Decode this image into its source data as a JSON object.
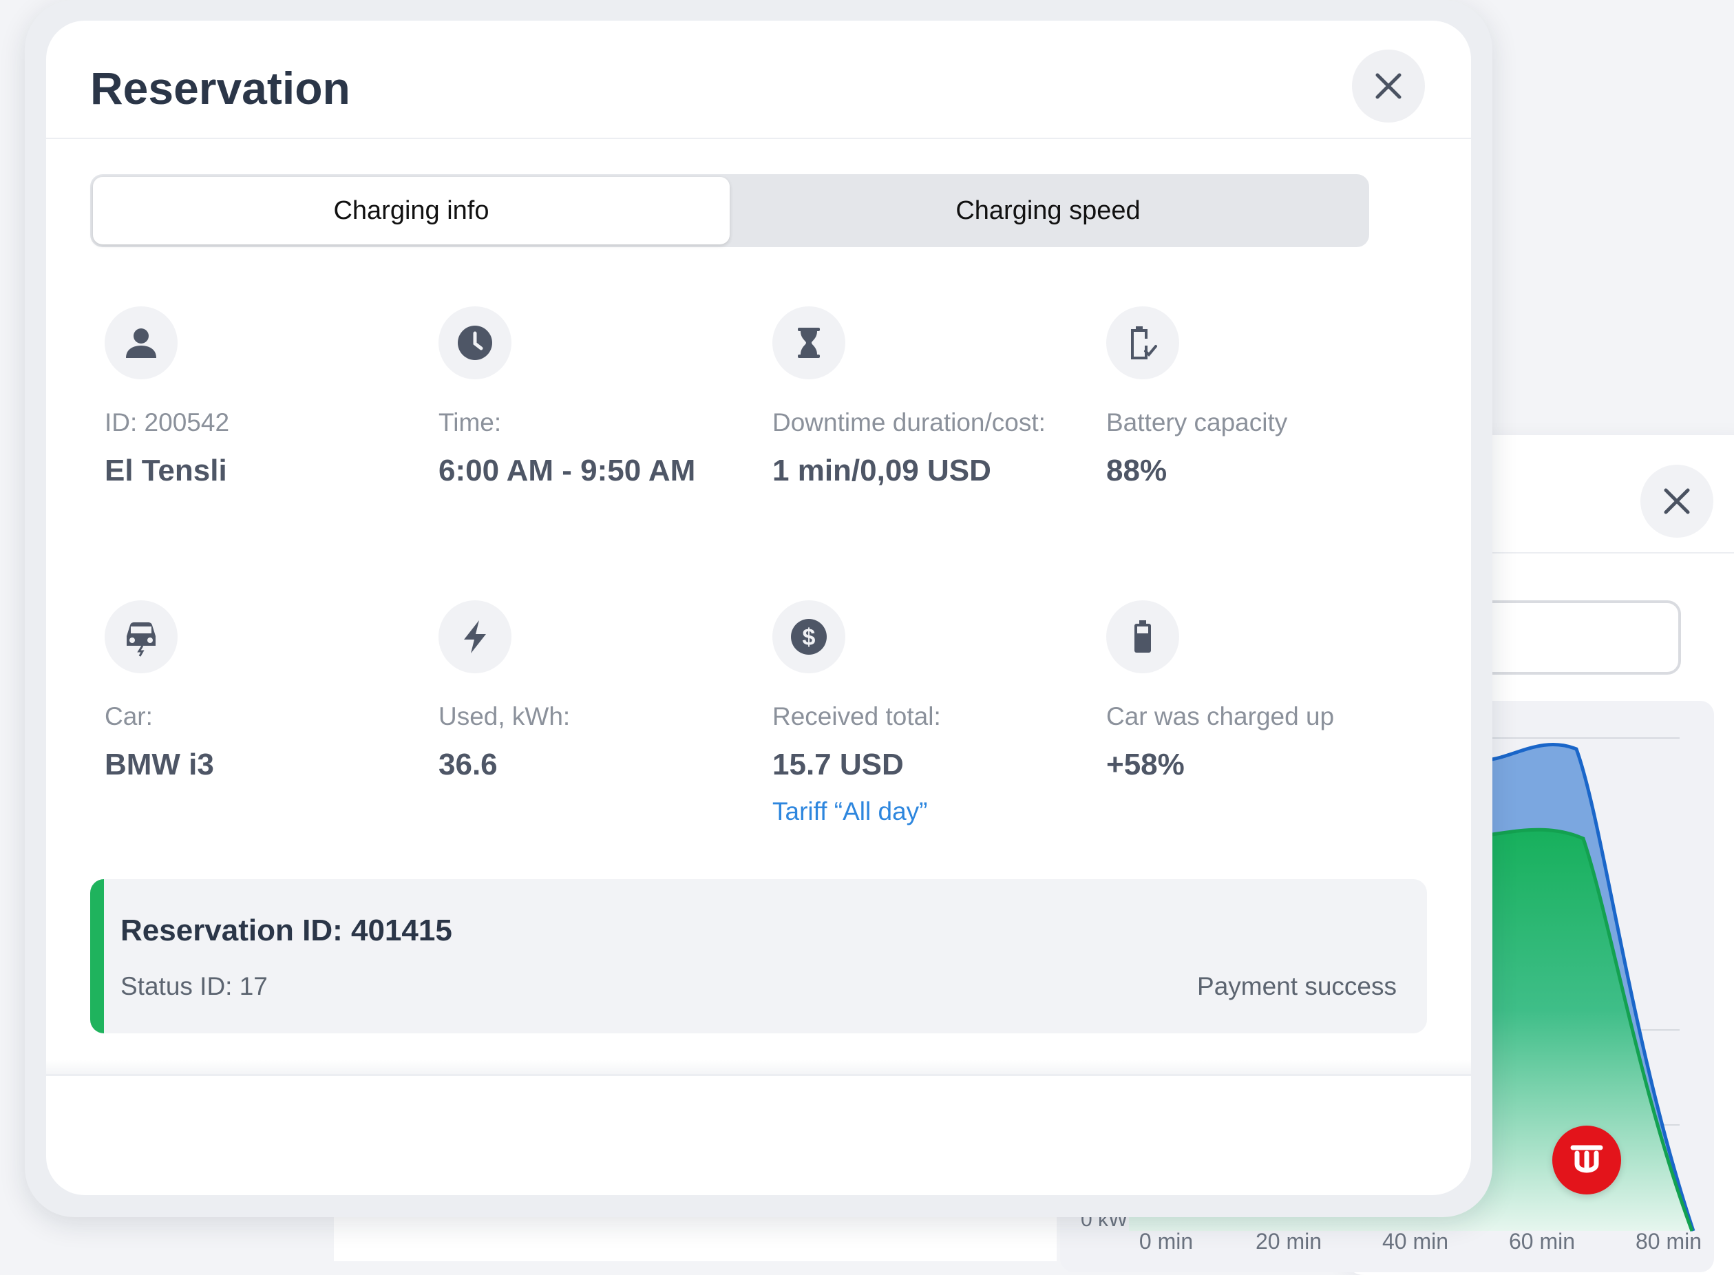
{
  "modal": {
    "title": "Reservation",
    "close_icon": "close-icon"
  },
  "tabs": [
    {
      "label": "Charging info",
      "active": true
    },
    {
      "label": "Charging speed",
      "active": false
    }
  ],
  "stats": {
    "user": {
      "icon": "person-icon",
      "label": "ID: 200542",
      "value": "El Tensli"
    },
    "time": {
      "icon": "clock-icon",
      "label": "Time:",
      "value": "6:00 AM - 9:50 AM"
    },
    "downtime": {
      "icon": "hourglass-icon",
      "label": "Downtime duration/cost:",
      "value": "1 min/0,09 USD"
    },
    "battery_capacity": {
      "icon": "battery-check-icon",
      "label": "Battery capacity",
      "value": "88%"
    },
    "car": {
      "icon": "car-icon",
      "label": "Car:",
      "value": "BMW i3"
    },
    "used": {
      "icon": "lightning-icon",
      "label": "Used, kWh:",
      "value": "36.6"
    },
    "received": {
      "icon": "dollar-icon",
      "label": "Received total:",
      "value": "15.7 USD",
      "link": "Tariff “All day”"
    },
    "charged_up": {
      "icon": "battery-icon",
      "label": "Car was charged up",
      "value": "+58%"
    }
  },
  "reservation": {
    "id_text": "Reservation ID: 401415",
    "status_text": "Status ID: 17",
    "payment_text": "Payment success",
    "accent_color": "#1fb35d"
  },
  "background_panel": {
    "close_icon": "close-icon",
    "chart_axis": {
      "y_min_label": "0 kW",
      "x_ticks": [
        "0 min",
        "20 min",
        "40 min",
        "60 min",
        "80 min"
      ]
    },
    "brand_badge_color": "#e3141b"
  },
  "colors": {
    "link": "#2d86de",
    "series_blue": "#1a66c9",
    "series_green": "#17b05c"
  }
}
